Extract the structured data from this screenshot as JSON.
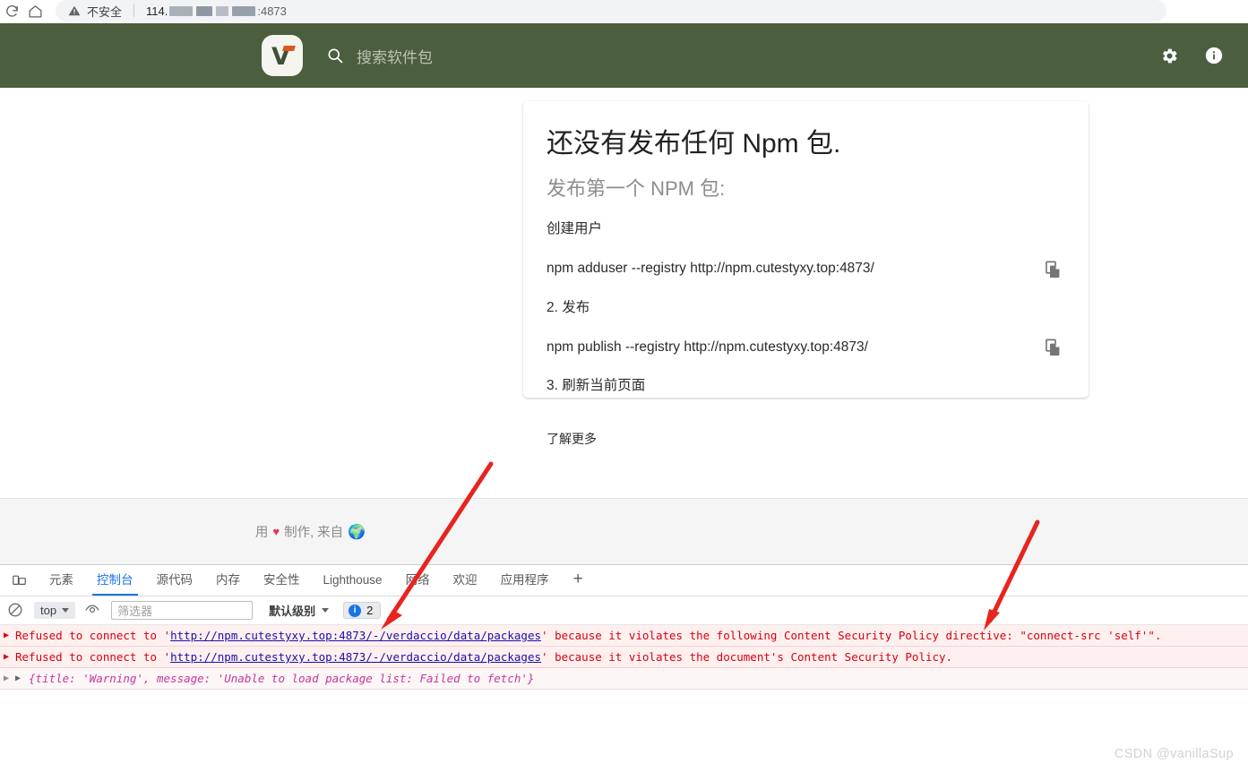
{
  "browser": {
    "reload_icon": "reload-icon",
    "home_icon": "home-icon",
    "security_label": "不安全",
    "url_prefix": "114.",
    "url_port": ":4873"
  },
  "app_header": {
    "logo_letter": "V",
    "search_placeholder": "搜索软件包",
    "settings_icon": "gear-icon",
    "info_icon": "info-icon",
    "background_color": "#4b5e3e"
  },
  "card": {
    "title": "还没有发布任何 Npm 包.",
    "subtitle": "发布第一个 NPM 包:",
    "step1_title": "创建用户",
    "step1_command": "npm adduser --registry http://npm.cutestyxy.top:4873/",
    "step2_title": "2. 发布",
    "step2_command": "npm publish --registry http://npm.cutestyxy.top:4873/",
    "step3_title": "3. 刷新当前页面",
    "learn_more": "了解更多",
    "copy_icon": "copy-icon"
  },
  "footer": {
    "prefix": "用",
    "heart": "♥",
    "middle": "制作, 来自",
    "globe": "🌍"
  },
  "devtools": {
    "device_toolbar_icon": "device-toolbar-icon",
    "tabs": [
      {
        "label": "元素",
        "active": false
      },
      {
        "label": "控制台",
        "active": true
      },
      {
        "label": "源代码",
        "active": false
      },
      {
        "label": "内存",
        "active": false
      },
      {
        "label": "安全性",
        "active": false
      },
      {
        "label": "Lighthouse",
        "active": false
      },
      {
        "label": "网络",
        "active": false
      },
      {
        "label": "欢迎",
        "active": false
      },
      {
        "label": "应用程序",
        "active": false
      }
    ],
    "add_tab_label": "+",
    "toolbar": {
      "clear_icon": "clear-console-icon",
      "context_value": "top",
      "eye_icon": "live-expression-icon",
      "filter_placeholder": "筛选器",
      "level_label": "默认级别",
      "issues_count": "2",
      "issues_dot_icon": "info-badge-icon"
    },
    "console": [
      {
        "type": "error",
        "pre": "Refused to connect to '",
        "link": "http://npm.cutestyxy.top:4873/-/verdaccio/data/packages",
        "post": "' because it violates the following Content Security Policy directive: \"connect-src 'self'\"."
      },
      {
        "type": "error",
        "pre": "Refused to connect to '",
        "link": "http://npm.cutestyxy.top:4873/-/verdaccio/data/packages",
        "post": "' because it violates the document's Content Security Policy."
      },
      {
        "type": "object",
        "text": "{title: 'Warning', message: 'Unable to load package list: Failed to fetch'}"
      }
    ]
  },
  "annotations": {
    "arrow_color": "#e8241f",
    "arrow1_name": "red-arrow-to-console-link",
    "arrow2_name": "red-arrow-to-csp-directive"
  },
  "watermark": {
    "text": "CSDN @vanillaSup"
  }
}
